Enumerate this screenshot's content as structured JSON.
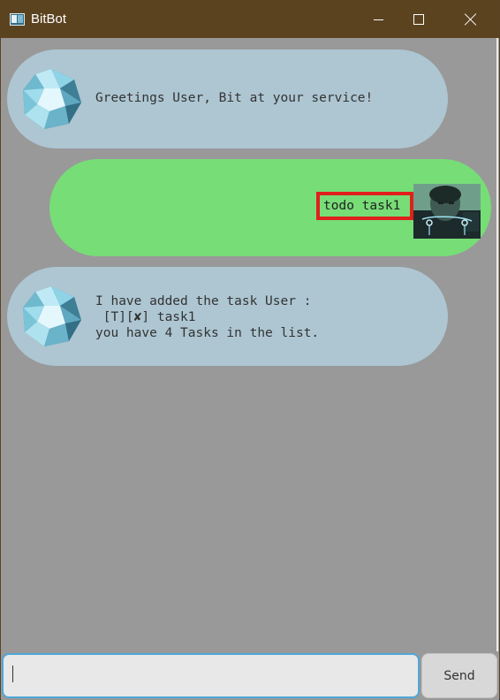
{
  "window": {
    "title": "BitBot",
    "controls": {
      "minimize": "minimize",
      "maximize": "maximize",
      "close": "close"
    }
  },
  "colors": {
    "titlebar": "#5b4320",
    "chat_bg": "#999999",
    "bot_bubble": "#adc6d2",
    "user_bubble": "#77dd77",
    "highlight": "#e0201b"
  },
  "messages": [
    {
      "sender": "bot",
      "avatar": "polyhedron-icon",
      "text": "Greetings User, Bit at your service!"
    },
    {
      "sender": "user",
      "avatar": "user-photo",
      "text": "todo task1"
    },
    {
      "sender": "bot",
      "avatar": "polyhedron-icon",
      "text": "I have added the task User :\n [T][✘] task1\nyou have 4 Tasks in the list."
    }
  ],
  "input": {
    "value": "",
    "placeholder": ""
  },
  "send_button": {
    "label": "Send"
  }
}
